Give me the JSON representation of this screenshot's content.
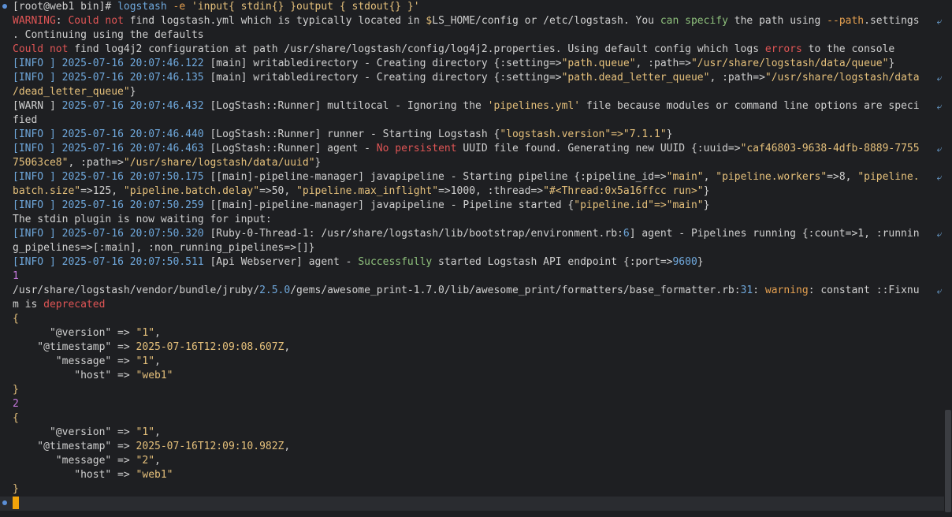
{
  "colors": {
    "default": "#d0d0d0",
    "red": "#e05555",
    "green": "#8ec07c",
    "yellow": "#e5c07b",
    "blue": "#6fa8dc",
    "orange": "#e5a050",
    "purple": "#c678dd",
    "cursor": "#f0a30a"
  },
  "wrap_glyph": "⤶",
  "lines": [
    {
      "mark": true,
      "segs": [
        [
          "[root@web1 bin]",
          "default"
        ],
        [
          "# ",
          "default"
        ],
        [
          "logstash",
          "blue"
        ],
        [
          " -e ",
          "orange"
        ],
        [
          "'input{ stdin{} }output { stdout{} }'",
          "yellow"
        ]
      ]
    },
    {
      "wrap": true,
      "segs": [
        [
          "WARNING",
          "red"
        ],
        [
          ": ",
          "default"
        ],
        [
          "Could not",
          "red"
        ],
        [
          " find logstash.yml which is typically located in ",
          "default"
        ],
        [
          "$",
          "yellow"
        ],
        [
          "LS_HOME/config or /etc/logstash. You ",
          "default"
        ],
        [
          "can specify",
          "green"
        ],
        [
          " the path using ",
          "default"
        ],
        [
          "--path",
          "orange"
        ],
        [
          ".settings",
          "default"
        ]
      ]
    },
    {
      "segs": [
        [
          ". Continuing using the defaults",
          "default"
        ]
      ]
    },
    {
      "segs": [
        [
          "Could not",
          "red"
        ],
        [
          " find log4j2 configuration at path /usr/share/logstash/config/log4j2.properties. Using default config which logs ",
          "default"
        ],
        [
          "errors",
          "red"
        ],
        [
          " to the console",
          "default"
        ]
      ]
    },
    {
      "segs": [
        [
          "[INFO ]",
          "blue"
        ],
        [
          " 2025-07-16 20:07:46.122 ",
          "blue"
        ],
        [
          "[main]",
          "default"
        ],
        [
          " writabledirectory - Creating directory {:setting=>",
          "default"
        ],
        [
          "\"path.queue\"",
          "yellow"
        ],
        [
          ", :path=>",
          "default"
        ],
        [
          "\"/usr/share/logstash/data/queue\"",
          "yellow"
        ],
        [
          "}",
          "default"
        ]
      ]
    },
    {
      "wrap": true,
      "segs": [
        [
          "[INFO ]",
          "blue"
        ],
        [
          " 2025-07-16 20:07:46.135 ",
          "blue"
        ],
        [
          "[main]",
          "default"
        ],
        [
          " writabledirectory - Creating directory {:setting=>",
          "default"
        ],
        [
          "\"path.dead_letter_queue\"",
          "yellow"
        ],
        [
          ", :path=>",
          "default"
        ],
        [
          "\"/usr/share/logstash/data",
          "yellow"
        ]
      ]
    },
    {
      "segs": [
        [
          "/dead_letter_queue\"",
          "yellow"
        ],
        [
          "}",
          "default"
        ]
      ]
    },
    {
      "wrap": true,
      "segs": [
        [
          "[WARN ]",
          "default"
        ],
        [
          " 2025-07-16 20:07:46.432 ",
          "blue"
        ],
        [
          "[LogStash::Runner] multilocal - Ignoring the ",
          "default"
        ],
        [
          "'pipelines.yml'",
          "yellow"
        ],
        [
          " file because modules or command line options are speci",
          "default"
        ]
      ]
    },
    {
      "segs": [
        [
          "fied",
          "default"
        ]
      ]
    },
    {
      "segs": [
        [
          "[INFO ]",
          "blue"
        ],
        [
          " 2025-07-16 20:07:46.440 ",
          "blue"
        ],
        [
          "[LogStash::Runner] runner - Starting Logstash {",
          "default"
        ],
        [
          "\"logstash.version\"=>\"7.1.1\"",
          "yellow"
        ],
        [
          "}",
          "default"
        ]
      ]
    },
    {
      "wrap": true,
      "segs": [
        [
          "[INFO ]",
          "blue"
        ],
        [
          " 2025-07-16 20:07:46.463 ",
          "blue"
        ],
        [
          "[LogStash::Runner] agent - ",
          "default"
        ],
        [
          "No persistent",
          "red"
        ],
        [
          " UUID file found. Generating new UUID {:uuid=>",
          "default"
        ],
        [
          "\"caf46803-9638-4dfb-8889-7755",
          "yellow"
        ]
      ]
    },
    {
      "segs": [
        [
          "75063ce8\"",
          "yellow"
        ],
        [
          ", :path=>",
          "default"
        ],
        [
          "\"/usr/share/logstash/data/uuid\"",
          "yellow"
        ],
        [
          "}",
          "default"
        ]
      ]
    },
    {
      "wrap": true,
      "segs": [
        [
          "[INFO ]",
          "blue"
        ],
        [
          " 2025-07-16 20:07:50.175 ",
          "blue"
        ],
        [
          "[[main]-pipeline-manager] javapipeline - Starting pipeline {:pipeline_id=>",
          "default"
        ],
        [
          "\"main\"",
          "yellow"
        ],
        [
          ", ",
          "default"
        ],
        [
          "\"pipeline.workers\"",
          "yellow"
        ],
        [
          "=>8, ",
          "default"
        ],
        [
          "\"pipeline.",
          "yellow"
        ]
      ]
    },
    {
      "segs": [
        [
          "batch.size\"",
          "yellow"
        ],
        [
          "=>125, ",
          "default"
        ],
        [
          "\"pipeline.batch.delay\"",
          "yellow"
        ],
        [
          "=>50, ",
          "default"
        ],
        [
          "\"pipeline.max_inflight\"",
          "yellow"
        ],
        [
          "=>1000, :thread=>",
          "default"
        ],
        [
          "\"#<Thread:0x5a16ffcc run>\"",
          "yellow"
        ],
        [
          "}",
          "default"
        ]
      ]
    },
    {
      "segs": [
        [
          "[INFO ]",
          "blue"
        ],
        [
          " 2025-07-16 20:07:50.259 ",
          "blue"
        ],
        [
          "[[main]-pipeline-manager] javapipeline - Pipeline started {",
          "default"
        ],
        [
          "\"pipeline.id\"=>\"main\"",
          "yellow"
        ],
        [
          "}",
          "default"
        ]
      ]
    },
    {
      "segs": [
        [
          "The stdin plugin is now waiting for input:",
          "default"
        ]
      ]
    },
    {
      "wrap": true,
      "segs": [
        [
          "[INFO ]",
          "blue"
        ],
        [
          " 2025-07-16 20:07:50.320 ",
          "blue"
        ],
        [
          "[Ruby-0-Thread-1: /usr/share/logstash/lib/bootstrap/environment.rb:",
          "default"
        ],
        [
          "6",
          "blue"
        ],
        [
          "] agent - Pipelines running {:count=>1, :runnin",
          "default"
        ]
      ]
    },
    {
      "segs": [
        [
          "g_pipelines=>[:main], :non_running_pipelines=>[]}",
          "default"
        ]
      ]
    },
    {
      "segs": [
        [
          "[INFO ]",
          "blue"
        ],
        [
          " 2025-07-16 20:07:50.511 ",
          "blue"
        ],
        [
          "[Api Webserver] agent - ",
          "default"
        ],
        [
          "Successfully",
          "green"
        ],
        [
          " started Logstash API endpoint {:port=>",
          "default"
        ],
        [
          "9600",
          "blue"
        ],
        [
          "}",
          "default"
        ]
      ]
    },
    {
      "segs": [
        [
          "1",
          "purple"
        ]
      ]
    },
    {
      "wrap": true,
      "segs": [
        [
          "/usr/share/logstash/vendor/bundle/jruby/",
          "default"
        ],
        [
          "2.5.0",
          "blue"
        ],
        [
          "/gems/awesome_print-1.7.0/lib/awesome_print/formatters/base_formatter.rb:",
          "default"
        ],
        [
          "31",
          "blue"
        ],
        [
          ": ",
          "default"
        ],
        [
          "warning",
          "orange"
        ],
        [
          ": constant ::Fixnu",
          "default"
        ]
      ]
    },
    {
      "segs": [
        [
          "m is ",
          "default"
        ],
        [
          "deprecated",
          "red"
        ]
      ]
    },
    {
      "segs": [
        [
          "{",
          "yellow"
        ]
      ]
    },
    {
      "segs": [
        [
          "      \"@version\" => ",
          "default"
        ],
        [
          "\"1\"",
          "yellow"
        ],
        [
          ",",
          "default"
        ]
      ]
    },
    {
      "segs": [
        [
          "    \"@timestamp\" => ",
          "default"
        ],
        [
          "2025-07-16T12:09:08.607Z",
          "yellow"
        ],
        [
          ",",
          "default"
        ]
      ]
    },
    {
      "segs": [
        [
          "       \"message\" => ",
          "default"
        ],
        [
          "\"1\"",
          "yellow"
        ],
        [
          ",",
          "default"
        ]
      ]
    },
    {
      "segs": [
        [
          "          \"host\" => ",
          "default"
        ],
        [
          "\"web1\"",
          "yellow"
        ]
      ]
    },
    {
      "segs": [
        [
          "}",
          "yellow"
        ]
      ]
    },
    {
      "segs": [
        [
          "2",
          "purple"
        ]
      ]
    },
    {
      "segs": [
        [
          "{",
          "yellow"
        ]
      ]
    },
    {
      "segs": [
        [
          "      \"@version\" => ",
          "default"
        ],
        [
          "\"1\"",
          "yellow"
        ],
        [
          ",",
          "default"
        ]
      ]
    },
    {
      "segs": [
        [
          "    \"@timestamp\" => ",
          "default"
        ],
        [
          "2025-07-16T12:09:10.982Z",
          "yellow"
        ],
        [
          ",",
          "default"
        ]
      ]
    },
    {
      "segs": [
        [
          "       \"message\" => ",
          "default"
        ],
        [
          "\"2\"",
          "yellow"
        ],
        [
          ",",
          "default"
        ]
      ]
    },
    {
      "segs": [
        [
          "          \"host\" => ",
          "default"
        ],
        [
          "\"web1\"",
          "yellow"
        ]
      ]
    },
    {
      "segs": [
        [
          "}",
          "yellow"
        ]
      ]
    },
    {
      "cursor": true,
      "mark": true,
      "segs": []
    }
  ]
}
